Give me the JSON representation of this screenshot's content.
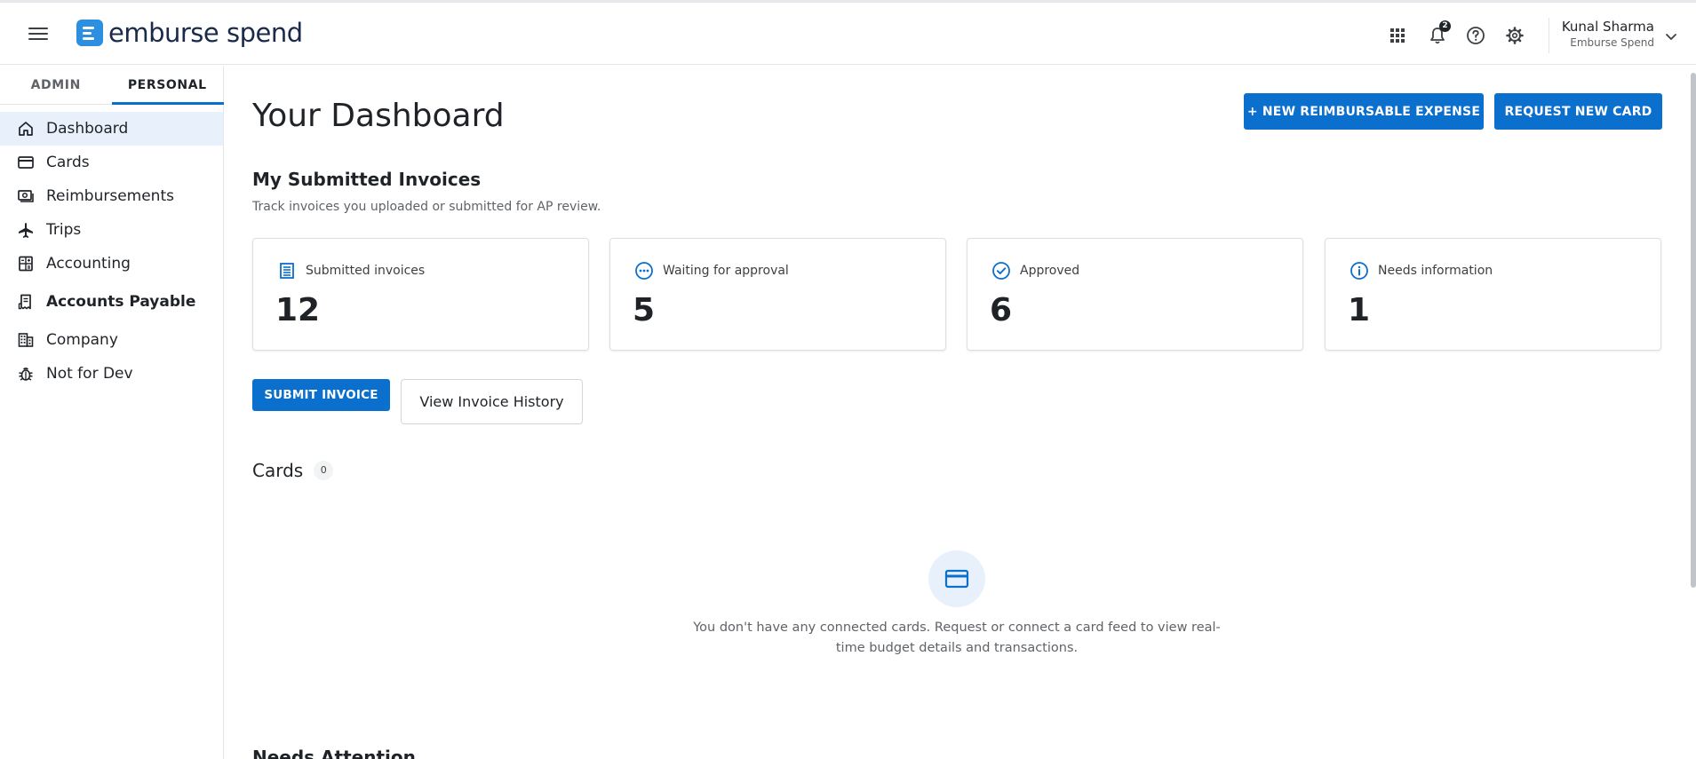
{
  "header": {
    "logo_text": "emburse spend",
    "notification_count": "2",
    "user_name": "Kunal Sharma",
    "user_org": "Emburse Spend",
    "icons": [
      "menu-icon",
      "apps-grid-icon",
      "bell-icon",
      "help-icon",
      "gear-icon",
      "chevron-down-icon"
    ]
  },
  "sidebar": {
    "tabs": [
      {
        "label": "ADMIN",
        "active": false
      },
      {
        "label": "PERSONAL",
        "active": true
      }
    ],
    "items": [
      {
        "label": "Dashboard",
        "icon": "home-icon",
        "active": true
      },
      {
        "label": "Cards",
        "icon": "credit-card-icon"
      },
      {
        "label": "Reimbursements",
        "icon": "cash-icon"
      },
      {
        "label": "Trips",
        "icon": "airplane-icon"
      },
      {
        "label": "Accounting",
        "icon": "calculator-icon"
      },
      {
        "label": "Accounts Payable",
        "icon": "receipt-icon",
        "bold": true
      },
      {
        "label": "Company",
        "icon": "building-icon"
      },
      {
        "label": "Not for Dev",
        "icon": "bug-icon"
      }
    ]
  },
  "main": {
    "title": "Your Dashboard",
    "new_expense_label": "+ NEW REIMBURSABLE EXPENSE",
    "request_card_label": "REQUEST NEW CARD",
    "invoices": {
      "title": "My Submitted Invoices",
      "subtitle": "Track invoices you uploaded or submitted for AP review.",
      "stats": [
        {
          "label": "Submitted invoices",
          "value": "12",
          "icon": "document-list-icon"
        },
        {
          "label": "Waiting for approval",
          "value": "5",
          "icon": "pending-dots-icon"
        },
        {
          "label": "Approved",
          "value": "6",
          "icon": "check-circle-icon"
        },
        {
          "label": "Needs information",
          "value": "1",
          "icon": "info-icon"
        }
      ],
      "submit_label": "SUBMIT INVOICE",
      "history_label": "View Invoice History"
    },
    "cards": {
      "title": "Cards",
      "count": "0",
      "empty_text": "You don't have any connected cards. Request or connect a card feed to view real-time budget details and transactions."
    },
    "next_section_title": "Needs Attention"
  },
  "colors": {
    "accent": "#0b6fce",
    "active_nav_bg": "#e8f1fb",
    "logo": "#2d8fe0"
  }
}
